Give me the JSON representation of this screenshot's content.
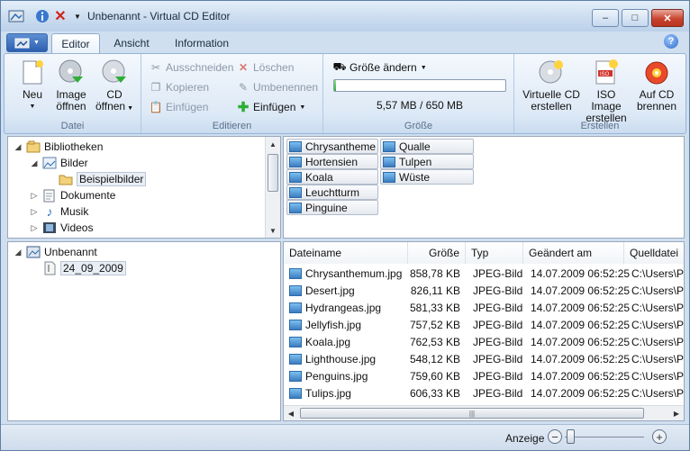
{
  "window": {
    "title": "Unbenannt - Virtual CD Editor",
    "controls": {
      "minimize": "–",
      "maximize": "□",
      "close": "✕"
    }
  },
  "quick_access": [
    "app-icon",
    "info-icon",
    "delete-icon",
    "customize-dropdown-icon"
  ],
  "tabs": [
    {
      "label": "Editor",
      "active": true
    },
    {
      "label": "Ansicht",
      "active": false
    },
    {
      "label": "Information",
      "active": false
    }
  ],
  "ribbon": {
    "datei": {
      "label": "Datei",
      "neu": "Neu",
      "image_oeffnen": [
        "Image",
        "öffnen"
      ],
      "cd_oeffnen": [
        "CD",
        "öffnen"
      ]
    },
    "editieren": {
      "label": "Editieren",
      "ausschneiden": "Ausschneiden",
      "kopieren": "Kopieren",
      "einfuegen_disabled": "Einfügen",
      "loeschen": "Löschen",
      "umbenennen": "Umbenennen",
      "einfuegen": "Einfügen"
    },
    "groesse": {
      "label": "Größe",
      "groesse_aendern": "Größe ändern",
      "progress_fraction": 0.009,
      "size_text": "5,57 MB / 650 MB"
    },
    "erstellen": {
      "label": "Erstellen",
      "virtuelle_cd": [
        "Virtuelle CD",
        "erstellen"
      ],
      "iso_image": [
        "ISO Image",
        "erstellen"
      ],
      "auf_cd": [
        "Auf CD",
        "brennen"
      ]
    }
  },
  "library_tree": [
    {
      "label": "Bibliotheken",
      "icon": "library-icon",
      "expander": "◢"
    },
    {
      "label": "Bilder",
      "icon": "pictures-icon",
      "expander": "◢"
    },
    {
      "label": "Beispielbilder",
      "icon": "folder-icon",
      "expander": "",
      "selected": true
    },
    {
      "label": "Dokumente",
      "icon": "documents-icon",
      "expander": "▷"
    },
    {
      "label": "Musik",
      "icon": "music-icon",
      "expander": "▷"
    },
    {
      "label": "Videos",
      "icon": "videos-icon",
      "expander": "▷"
    }
  ],
  "source_files": [
    "Chrysantheme",
    "Qualle",
    "Hortensien",
    "Tulpen",
    "Koala",
    "Wüste",
    "Leuchtturm",
    "Pinguine"
  ],
  "project_tree": [
    {
      "label": "Unbenannt",
      "icon": "cd-project-icon",
      "expander": "◢"
    },
    {
      "label": "24_09_2009",
      "icon": "disc-folder-icon",
      "expander": "",
      "selected": true
    }
  ],
  "file_columns": [
    "Dateiname",
    "Größe",
    "Typ",
    "Geändert am",
    "Quelldatei"
  ],
  "files": [
    {
      "name": "Chrysanthemum.jpg",
      "size": "858,78 KB",
      "type": "JPEG-Bild",
      "modified": "14.07.2009 06:52:25",
      "source": "C:\\Users\\Pu"
    },
    {
      "name": "Desert.jpg",
      "size": "826,11 KB",
      "type": "JPEG-Bild",
      "modified": "14.07.2009 06:52:25",
      "source": "C:\\Users\\Pu"
    },
    {
      "name": "Hydrangeas.jpg",
      "size": "581,33 KB",
      "type": "JPEG-Bild",
      "modified": "14.07.2009 06:52:25",
      "source": "C:\\Users\\Pu"
    },
    {
      "name": "Jellyfish.jpg",
      "size": "757,52 KB",
      "type": "JPEG-Bild",
      "modified": "14.07.2009 06:52:25",
      "source": "C:\\Users\\Pu"
    },
    {
      "name": "Koala.jpg",
      "size": "762,53 KB",
      "type": "JPEG-Bild",
      "modified": "14.07.2009 06:52:25",
      "source": "C:\\Users\\Pu"
    },
    {
      "name": "Lighthouse.jpg",
      "size": "548,12 KB",
      "type": "JPEG-Bild",
      "modified": "14.07.2009 06:52:25",
      "source": "C:\\Users\\Pu"
    },
    {
      "name": "Penguins.jpg",
      "size": "759,60 KB",
      "type": "JPEG-Bild",
      "modified": "14.07.2009 06:52:25",
      "source": "C:\\Users\\Pu"
    },
    {
      "name": "Tulips.jpg",
      "size": "606,33 KB",
      "type": "JPEG-Bild",
      "modified": "14.07.2009 06:52:25",
      "source": "C:\\Users\\Pu"
    }
  ],
  "statusbar": {
    "zoom_label": "Anzeige",
    "zoom_out": "−",
    "zoom_in": "+",
    "zoom_level": 0.05
  },
  "colors": {
    "accent": "#2f6bc7",
    "progress": "#2fae36",
    "close": "#c8442f"
  }
}
